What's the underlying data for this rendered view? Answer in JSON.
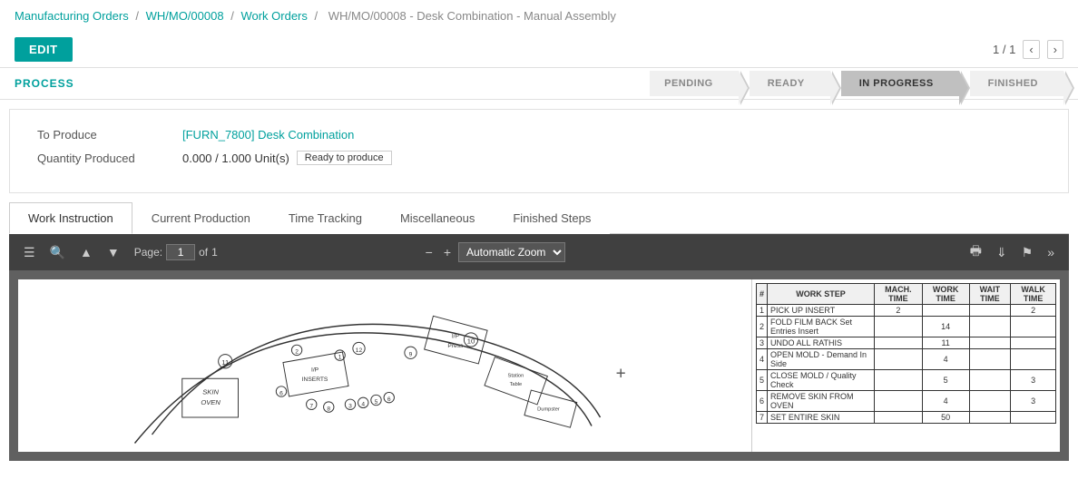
{
  "breadcrumb": {
    "items": [
      {
        "label": "Manufacturing Orders",
        "href": "#"
      },
      {
        "label": "WH/MO/00008",
        "href": "#"
      },
      {
        "label": "Work Orders",
        "href": "#"
      },
      {
        "label": "WH/MO/00008 - Desk Combination - Manual Assembly",
        "href": null
      }
    ]
  },
  "header": {
    "edit_label": "EDIT",
    "pagination_current": "1",
    "pagination_total": "1"
  },
  "process_nav": {
    "label": "PROCESS",
    "statuses": [
      "PENDING",
      "READY",
      "IN PROGRESS",
      "FINISHED"
    ]
  },
  "form": {
    "to_produce_label": "To Produce",
    "to_produce_link": "[FURN_7800] Desk Combination",
    "quantity_produced_label": "Quantity Produced",
    "quantity_value": "0.000 / 1.000 Unit(s)",
    "ready_badge": "Ready to produce"
  },
  "tabs": [
    {
      "label": "Work Instruction",
      "active": true
    },
    {
      "label": "Current Production",
      "active": false
    },
    {
      "label": "Time Tracking",
      "active": false
    },
    {
      "label": "Miscellaneous",
      "active": false
    },
    {
      "label": "Finished Steps",
      "active": false
    }
  ],
  "pdf_toolbar": {
    "page_label": "Page:",
    "page_current": "1",
    "page_of": "of",
    "page_total": "1",
    "zoom_option": "Automatic Zoom"
  },
  "work_table": {
    "headers": [
      "#",
      "WORK STEP",
      "MACH. TIME",
      "WORK TIME",
      "WAIT TIME",
      "WALK TIME"
    ],
    "rows": [
      [
        "1",
        "PICK UP INSERT",
        "2",
        "",
        "",
        "2"
      ],
      [
        "2",
        "FOLD FILM BACK Set Entries Insert",
        "",
        "14",
        "",
        ""
      ],
      [
        "3",
        "UNDO ALL RATHIS",
        "",
        "11",
        "",
        ""
      ],
      [
        "4",
        "OPEN MOLD - Demand In Side",
        "",
        "4",
        "",
        ""
      ],
      [
        "5",
        "CLOSE MOLD / Quality Check",
        "",
        "5",
        "",
        "3"
      ],
      [
        "6",
        "REMOVE SKIN FROM OVEN",
        "",
        "4",
        "",
        "3"
      ],
      [
        "7",
        "SET ENTIRE SKIN",
        "",
        "50",
        "",
        ""
      ]
    ]
  },
  "colors": {
    "teal": "#00a09d",
    "in_progress_bg": "#c0c0c0",
    "status_inactive": "#888"
  }
}
